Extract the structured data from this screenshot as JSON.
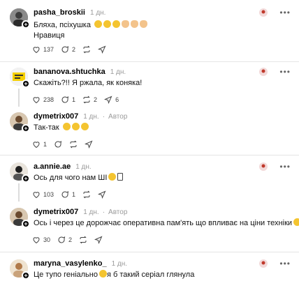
{
  "posts": [
    {
      "username": "pasha_broskii",
      "time": "1 дн.",
      "author_label": "",
      "lines": [
        "Бляха, псіхушка",
        "Нравиця"
      ],
      "emojis": [
        "grin",
        "grin",
        "grin",
        "hand",
        "hand",
        "hand"
      ],
      "likes": "137",
      "replies": "2",
      "reposts": "",
      "shares": ""
    },
    {
      "username": "bananova.shtuchka",
      "time": "1 дн.",
      "author_label": "",
      "lines": [
        "Скажіть?!! Я ржала, як коняка!"
      ],
      "likes": "238",
      "replies": "1",
      "reposts": "2",
      "shares": "6"
    },
    {
      "username": "dymetrix007",
      "time": "1 дн.",
      "author_label": "Автор",
      "lines": [
        "Так-так"
      ],
      "likes": "1",
      "replies": "",
      "reposts": "",
      "shares": ""
    },
    {
      "username": "a.annie.ae",
      "time": "1 дн.",
      "author_label": "",
      "lines": [
        "Ось для чого нам ШІ"
      ],
      "likes": "103",
      "replies": "1",
      "reposts": "",
      "shares": ""
    },
    {
      "username": "dymetrix007",
      "time": "1 дн.",
      "author_label": "Автор",
      "lines": [
        "Ось і через це дорожчає оперативна пам'ять що впливає на ціни техніки"
      ],
      "likes": "30",
      "replies": "2",
      "reposts": "",
      "shares": ""
    },
    {
      "username": "maryna_vasylenko_",
      "time": "1 дн.",
      "author_label": "",
      "lines": [
        "Це тупо геніально",
        "я б такий серіал глянула"
      ],
      "likes": "",
      "replies": "",
      "reposts": "",
      "shares": ""
    }
  ],
  "colors": {
    "accent": "#000000",
    "muted": "#9a9a9a",
    "separator": "#e5e5e5"
  }
}
